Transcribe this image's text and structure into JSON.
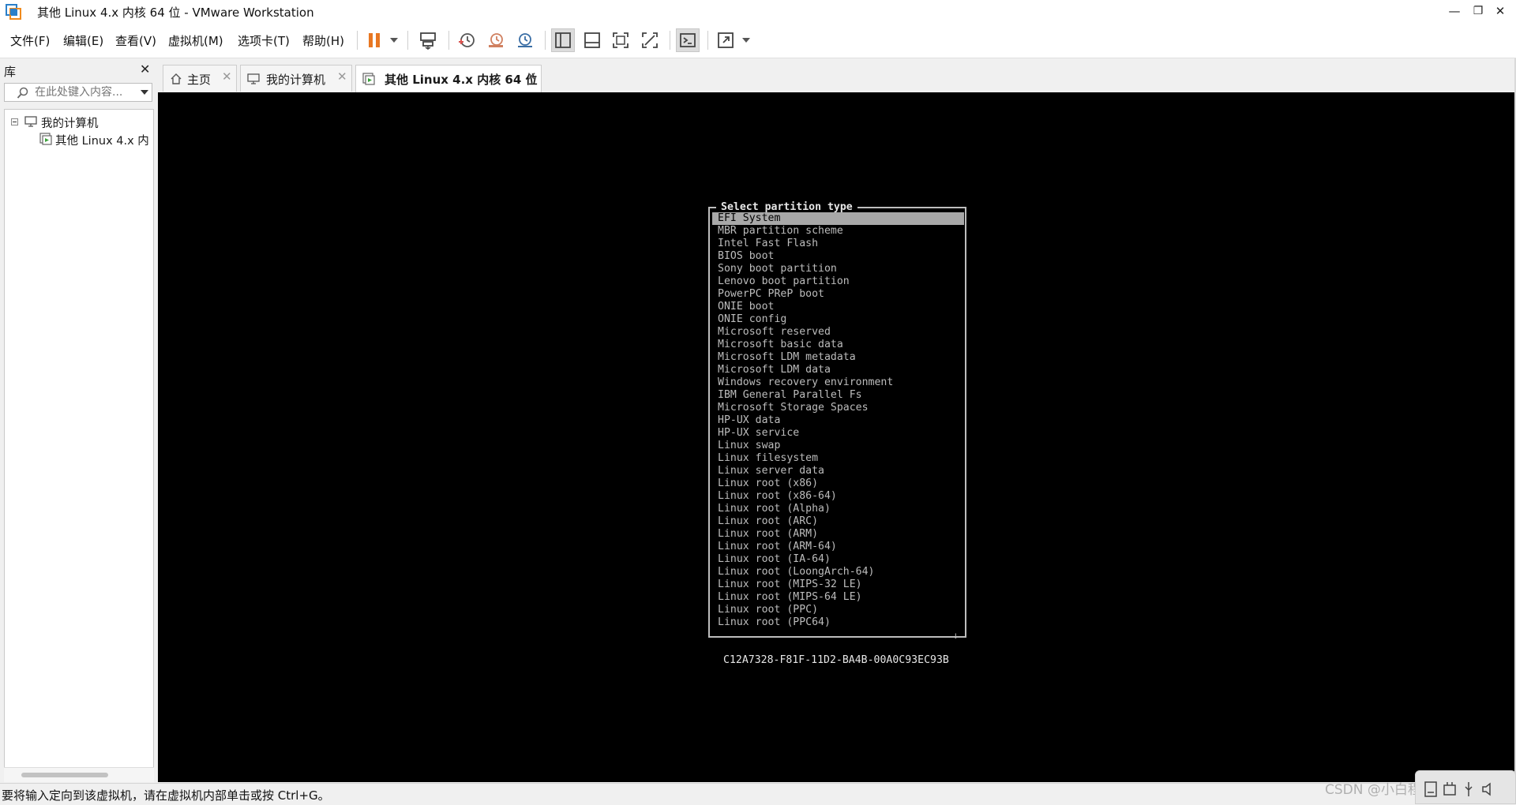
{
  "window": {
    "title": "其他 Linux 4.x 内核 64 位 - VMware Workstation",
    "minimize": "—",
    "restore": "❐",
    "close": "✕"
  },
  "menu": {
    "items": [
      "文件(F)",
      "编辑(E)",
      "查看(V)",
      "虚拟机(M)",
      "选项卡(T)",
      "帮助(H)"
    ]
  },
  "toolbar": {
    "buttons": [
      "pause-icon",
      "send-ctrl-alt-del-icon",
      "snapshot-icon",
      "revert-snapshot-icon",
      "snapshot-manager-icon",
      "library-view-icon",
      "thumbnail-view-icon",
      "fullscreen-icon",
      "unity-icon",
      "console-icon",
      "stretch-icon"
    ],
    "pause_color": "#e87722"
  },
  "library": {
    "title": "库",
    "close": "✕",
    "search_placeholder": "在此处键入内容...",
    "tree": {
      "root": "我的计算机",
      "child": "其他 Linux 4.x 内"
    }
  },
  "tabs": [
    {
      "label": "主页",
      "icon": "home-icon",
      "active": false
    },
    {
      "label": "我的计算机",
      "icon": "computer-icon",
      "active": false
    },
    {
      "label": "其他 Linux 4.x 内核 64 位",
      "icon": "vm-running-icon",
      "active": true
    }
  ],
  "vm": {
    "dialog_title": "Select partition type",
    "partition_types": [
      "EFI System",
      "MBR partition scheme",
      "Intel Fast Flash",
      "BIOS boot",
      "Sony boot partition",
      "Lenovo boot partition",
      "PowerPC PReP boot",
      "ONIE boot",
      "ONIE config",
      "Microsoft reserved",
      "Microsoft basic data",
      "Microsoft LDM metadata",
      "Microsoft LDM data",
      "Windows recovery environment",
      "IBM General Parallel Fs",
      "Microsoft Storage Spaces",
      "HP-UX data",
      "HP-UX service",
      "Linux swap",
      "Linux filesystem",
      "Linux server data",
      "Linux root (x86)",
      "Linux root (x86-64)",
      "Linux root (Alpha)",
      "Linux root (ARC)",
      "Linux root (ARM)",
      "Linux root (ARM-64)",
      "Linux root (IA-64)",
      "Linux root (LoongArch-64)",
      "Linux root (MIPS-32 LE)",
      "Linux root (MIPS-64 LE)",
      "Linux root (PPC)",
      "Linux root (PPC64)"
    ],
    "selected_index": 0,
    "scroll_indicator": "↓",
    "guid": "C12A7328-F81F-11D2-BA4B-00A0C93EC93B"
  },
  "status": {
    "text": "要将输入定向到该虚拟机，请在虚拟机内部单击或按 Ctrl+G。",
    "watermark": "CSDN @小白程序员Zhang"
  }
}
